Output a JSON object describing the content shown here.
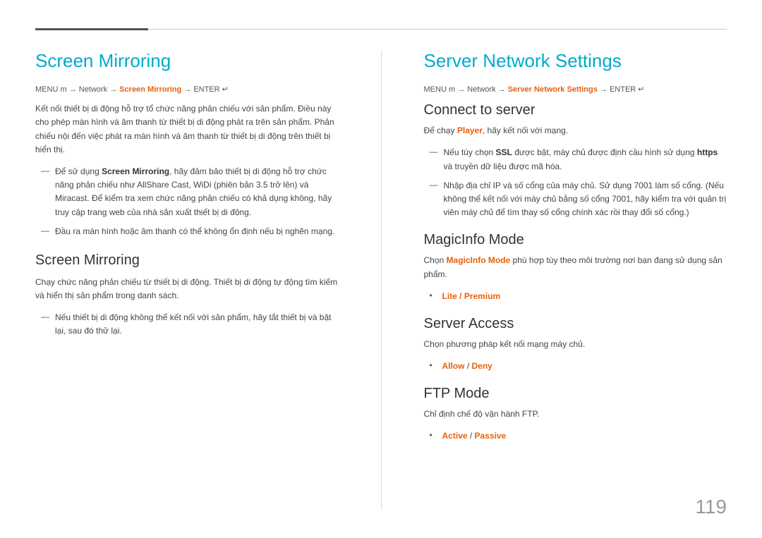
{
  "page": {
    "number": "119"
  },
  "left": {
    "section_title": "Screen Mirroring",
    "menu_path": {
      "prefix": "MENU ",
      "menu_icon": "☰",
      "parts": [
        {
          "text": "→ Network → ",
          "type": "normal"
        },
        {
          "text": "Screen Mirroring",
          "type": "orange"
        },
        {
          "text": " → ENTER ",
          "type": "normal"
        }
      ],
      "enter_icon": "↵"
    },
    "intro_text": "Kết nối thiết bị di động hỗ trợ tổ chức năng phản chiếu với sản phẩm. Điều này cho phép màn hình và âm thanh từ thiết bị di động phát ra trên sản phẩm. Phản chiếu nội đến việc phát ra màn hình và âm thanh từ thiết bị di động trên thiết bị hiển thị.",
    "notes": [
      {
        "text_parts": [
          {
            "text": "Để sử dụng ",
            "type": "normal"
          },
          {
            "text": "Screen Mirroring",
            "type": "bold-highlight"
          },
          {
            "text": ", hãy đảm bảo thiết bị di động hỗ trợ chức năng phản chiếu như AllShare Cast, WiDi (phiên bản 3.5 trở lên) và Miracast. Để kiểm tra xem chức năng phản chiếu có khả dụng không, hãy truy cập trang web của nhà sản xuất thiết bị di động.",
            "type": "normal"
          }
        ]
      },
      {
        "text_parts": [
          {
            "text": "Đầu ra màn hình hoặc âm thanh có thể không ổn định nếu bị nghẽn mạng.",
            "type": "normal"
          }
        ]
      }
    ],
    "subsection_title": "Screen Mirroring",
    "subsection_body": "Chạy chức năng phản chiếu từ thiết bị di động. Thiết bị di động tự động tìm kiếm và hiển thị sản phẩm trong danh sách.",
    "subsection_notes": [
      {
        "text_parts": [
          {
            "text": "Nếu thiết bị di động không thể kết nối với sản phẩm, hãy tắt thiết bị và bật lại, sau đó thử lại.",
            "type": "normal"
          }
        ]
      }
    ]
  },
  "right": {
    "section_title": "Server Network Settings",
    "menu_path": {
      "prefix": "MENU ",
      "menu_icon": "☰",
      "parts": [
        {
          "text": "→ Network → ",
          "type": "normal"
        },
        {
          "text": "Server Network Settings",
          "type": "orange"
        },
        {
          "text": " → ENTER ",
          "type": "normal"
        }
      ],
      "enter_icon": "↵"
    },
    "subsections": [
      {
        "title": "Connect to server",
        "body": "Để chạy Player, hãy kết nối với mạng.",
        "notes": [
          {
            "text_parts": [
              {
                "text": "Nếu tùy chọn ",
                "type": "normal"
              },
              {
                "text": "SSL",
                "type": "bold"
              },
              {
                "text": " được bật, máy chủ được định cầu hình sử dụng ",
                "type": "normal"
              },
              {
                "text": "https",
                "type": "bold"
              },
              {
                "text": " và truyền dữ liệu được mã hóa.",
                "type": "normal"
              }
            ]
          },
          {
            "text_parts": [
              {
                "text": "Nhập địa chỉ IP và số cổng của máy chủ. Sử dụng 7001 làm số cổng. (Nếu không thể kết nối với máy chủ bằng số cổng 7001, hãy kiểm tra với quản trị viên máy chủ để tìm thay số cổng chính xác rồi thay đổi số cổng.)",
                "type": "normal"
              }
            ]
          }
        ]
      },
      {
        "title": "MagicInfo Mode",
        "body_parts": [
          {
            "text": "Chọn ",
            "type": "normal"
          },
          {
            "text": "MagicInfo Mode",
            "type": "orange"
          },
          {
            "text": " phù hợp tùy theo môi trường nơi bạn đang sử dụng sản phẩm.",
            "type": "normal"
          }
        ],
        "bullets": [
          {
            "text": "Lite / Premium",
            "type": "orange"
          }
        ]
      },
      {
        "title": "Server Access",
        "body": "Chọn phương pháp kết nối mạng máy chủ.",
        "bullets": [
          {
            "text_parts": [
              {
                "text": "Allow",
                "type": "orange"
              },
              {
                "text": " / ",
                "type": "normal"
              },
              {
                "text": "Deny",
                "type": "orange"
              }
            ]
          }
        ]
      },
      {
        "title": "FTP Mode",
        "body": "Chỉ định chế độ vận hành FTP.",
        "bullets": [
          {
            "text_parts": [
              {
                "text": "Active",
                "type": "orange"
              },
              {
                "text": " / ",
                "type": "normal"
              },
              {
                "text": "Passive",
                "type": "orange"
              }
            ]
          }
        ]
      }
    ]
  }
}
